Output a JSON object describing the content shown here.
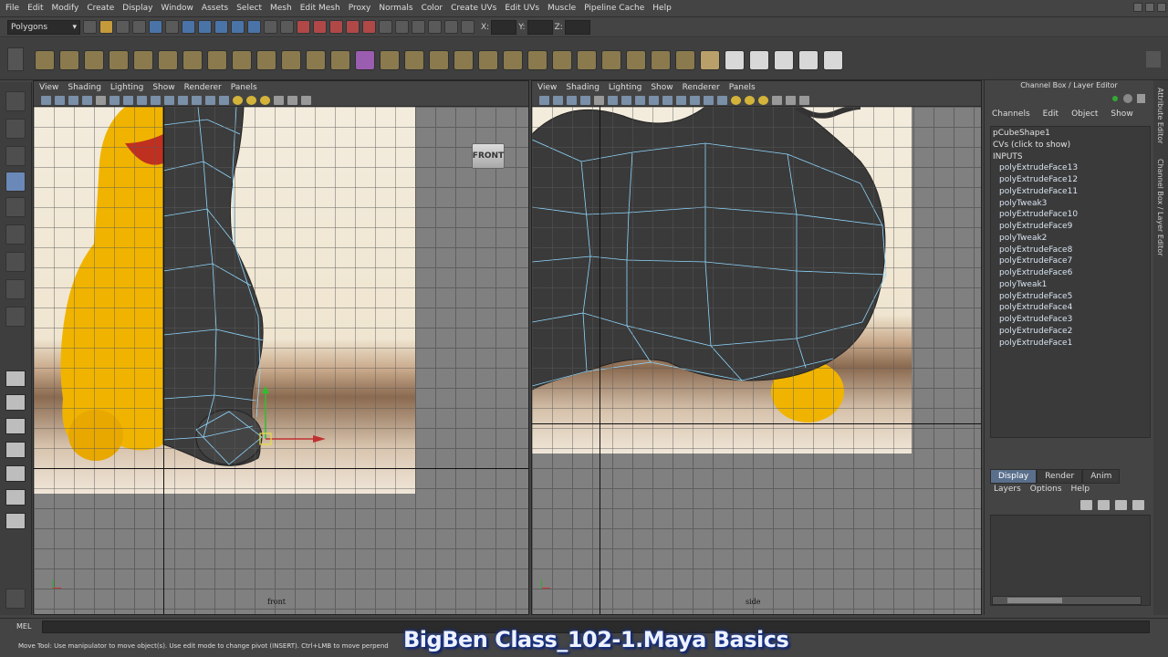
{
  "menu": [
    "File",
    "Edit",
    "Modify",
    "Create",
    "Display",
    "Window",
    "Assets",
    "Select",
    "Mesh",
    "Edit Mesh",
    "Proxy",
    "Normals",
    "Color",
    "Create UVs",
    "Edit UVs",
    "Muscle",
    "Pipeline Cache",
    "Help"
  ],
  "status_line": {
    "mode": "Polygons",
    "x_label": "X:",
    "y_label": "Y:",
    "z_label": "Z:"
  },
  "panel_menu": [
    "View",
    "Shading",
    "Lighting",
    "Show",
    "Renderer",
    "Panels"
  ],
  "front_panel": {
    "camera_label": "front",
    "viewcube_label": "FRONT"
  },
  "side_panel": {
    "camera_label": "side"
  },
  "channel_box": {
    "title": "Channel Box / Layer Editor",
    "tabs": [
      "Channels",
      "Edit",
      "Object",
      "Show"
    ],
    "shape": "pCubeShape1",
    "cvs": "CVs (click to show)",
    "inputs_label": "INPUTS",
    "inputs": [
      "polyExtrudeFace13",
      "polyExtrudeFace12",
      "polyExtrudeFace11",
      "polyTweak3",
      "polyExtrudeFace10",
      "polyExtrudeFace9",
      "polyTweak2",
      "polyExtrudeFace8",
      "polyExtrudeFace7",
      "polyExtrudeFace6",
      "polyTweak1",
      "polyExtrudeFace5",
      "polyExtrudeFace4",
      "polyExtrudeFace3",
      "polyExtrudeFace2",
      "polyExtrudeFace1"
    ]
  },
  "layer_editor": {
    "tabs": [
      "Display",
      "Render",
      "Anim"
    ],
    "active_tab": "Display",
    "menu": [
      "Layers",
      "Options",
      "Help"
    ]
  },
  "side_tabs": [
    "Attribute Editor",
    "Channel Box / Layer Editor"
  ],
  "command_line": {
    "label": "MEL"
  },
  "help_line": "Move Tool: Use manipulator to move object(s). Use edit mode to change pivot (INSERT).  Ctrl+LMB to move perpend",
  "watermark": "BigBen Class_102-1.Maya Basics",
  "colors": {
    "ui_bg": "#444444",
    "viewport_grid": "#808080",
    "mesh": "#3a3a3a",
    "wireframe": "#8fd8ff",
    "toy_yellow": "#f0b400",
    "watermark_glow": "#1a3a9a"
  }
}
